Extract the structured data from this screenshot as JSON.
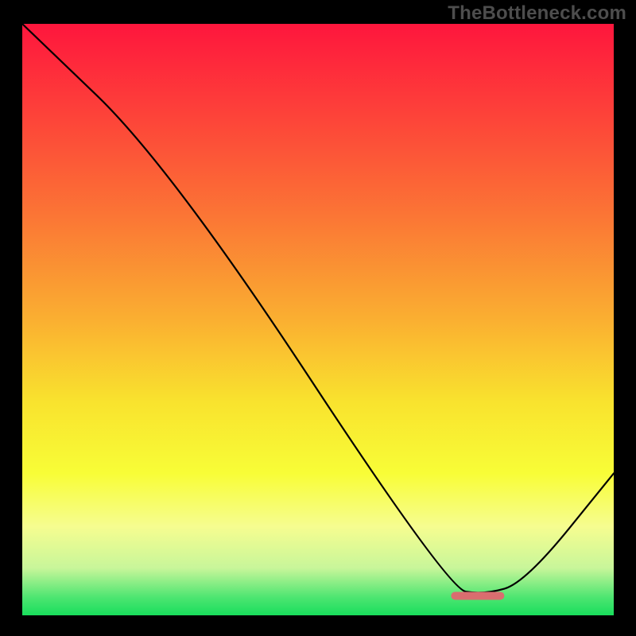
{
  "watermark": "TheBottleneck.com",
  "chart_data": {
    "type": "line",
    "title": "",
    "xlabel": "",
    "ylabel": "",
    "xlim": [
      0,
      100
    ],
    "ylim": [
      0,
      100
    ],
    "grid": false,
    "series": [
      {
        "name": "curve",
        "x": [
          0,
          25,
          72,
          78,
          85,
          100
        ],
        "values": [
          100,
          76,
          4.5,
          3.5,
          5.5,
          24
        ]
      }
    ],
    "marker": {
      "name": "optimal-range",
      "x_center": 77,
      "y": 3.3,
      "width": 9,
      "color": "#da6d6f"
    },
    "background_gradient": {
      "stops": [
        {
          "offset": 0.0,
          "color": "#fe163d"
        },
        {
          "offset": 0.16,
          "color": "#fd4439"
        },
        {
          "offset": 0.32,
          "color": "#fb7435"
        },
        {
          "offset": 0.5,
          "color": "#faaf31"
        },
        {
          "offset": 0.64,
          "color": "#f9e32e"
        },
        {
          "offset": 0.76,
          "color": "#f8fd37"
        },
        {
          "offset": 0.85,
          "color": "#f6fd90"
        },
        {
          "offset": 0.92,
          "color": "#c8f69a"
        },
        {
          "offset": 0.97,
          "color": "#4ce571"
        },
        {
          "offset": 1.0,
          "color": "#19de5c"
        }
      ]
    }
  }
}
